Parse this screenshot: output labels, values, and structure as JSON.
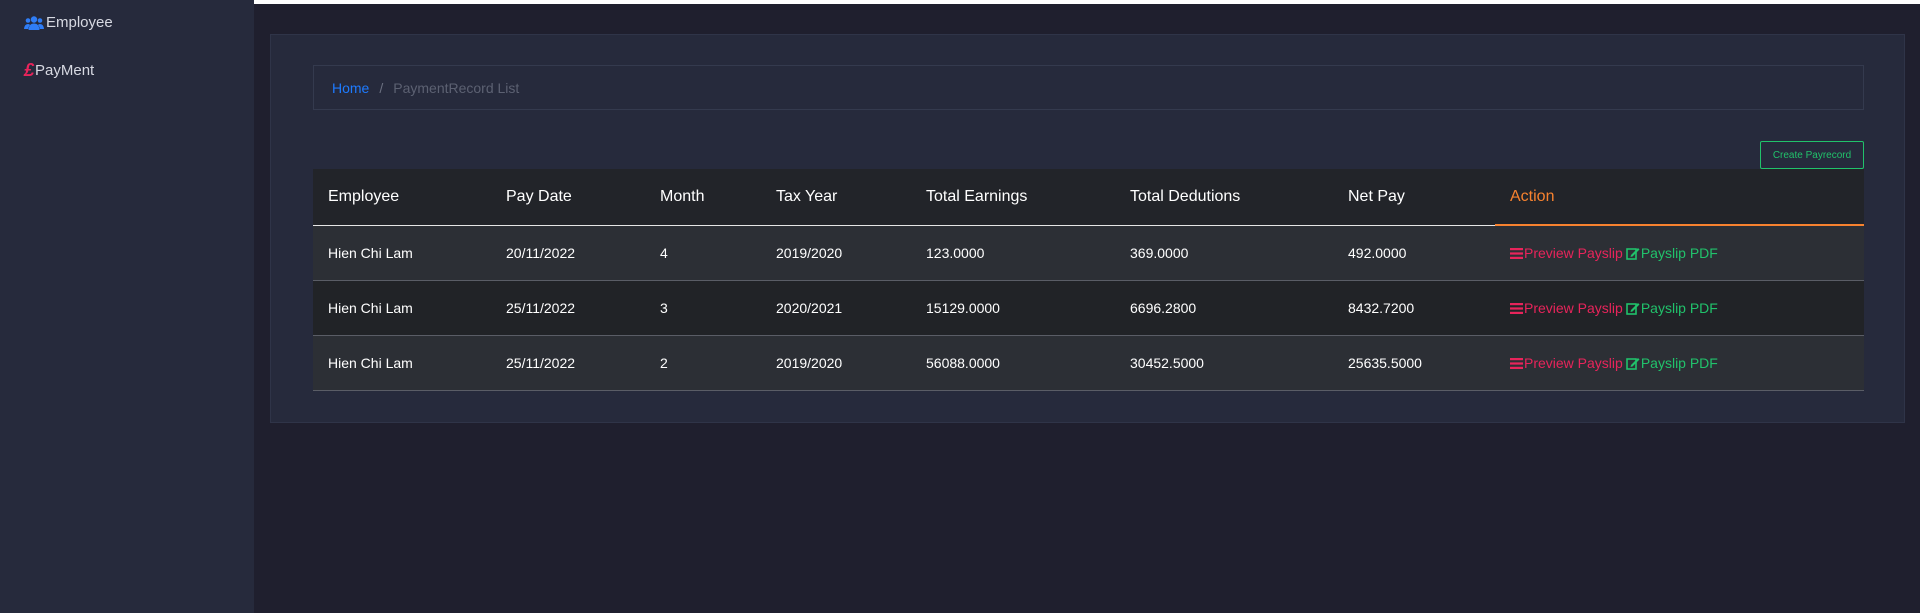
{
  "sidebar": {
    "items": [
      {
        "label": "Employee",
        "icon": "users-icon"
      },
      {
        "label": "PayMent",
        "icon": "pound-icon",
        "icon_glyph": "£"
      }
    ]
  },
  "breadcrumb": {
    "home": "Home",
    "separator": "/",
    "current": "PaymentRecord List"
  },
  "toolbar": {
    "create_label": "Create Payrecord"
  },
  "table": {
    "headers": [
      "Employee",
      "Pay Date",
      "Month",
      "Tax Year",
      "Total Earnings",
      "Total Dedutions",
      "Net Pay",
      "Action"
    ],
    "rows": [
      {
        "employee": "Hien Chi Lam",
        "pay_date": "20/11/2022",
        "month": "4",
        "tax_year": "2019/2020",
        "total_earnings": "123.0000",
        "total_deductions": "369.0000",
        "net_pay": "492.0000"
      },
      {
        "employee": "Hien Chi Lam",
        "pay_date": "25/11/2022",
        "month": "3",
        "tax_year": "2020/2021",
        "total_earnings": "15129.0000",
        "total_deductions": "6696.2800",
        "net_pay": "8432.7200"
      },
      {
        "employee": "Hien Chi Lam",
        "pay_date": "25/11/2022",
        "month": "2",
        "tax_year": "2019/2020",
        "total_earnings": "56088.0000",
        "total_deductions": "30452.5000",
        "net_pay": "25635.5000"
      }
    ],
    "actions": {
      "preview": "Preview Payslip",
      "pdf": "Payslip PDF"
    }
  },
  "colors": {
    "accent_blue": "#1e7bff",
    "accent_red": "#e8245b",
    "accent_green": "#21c26b",
    "accent_orange": "#f7822f"
  }
}
